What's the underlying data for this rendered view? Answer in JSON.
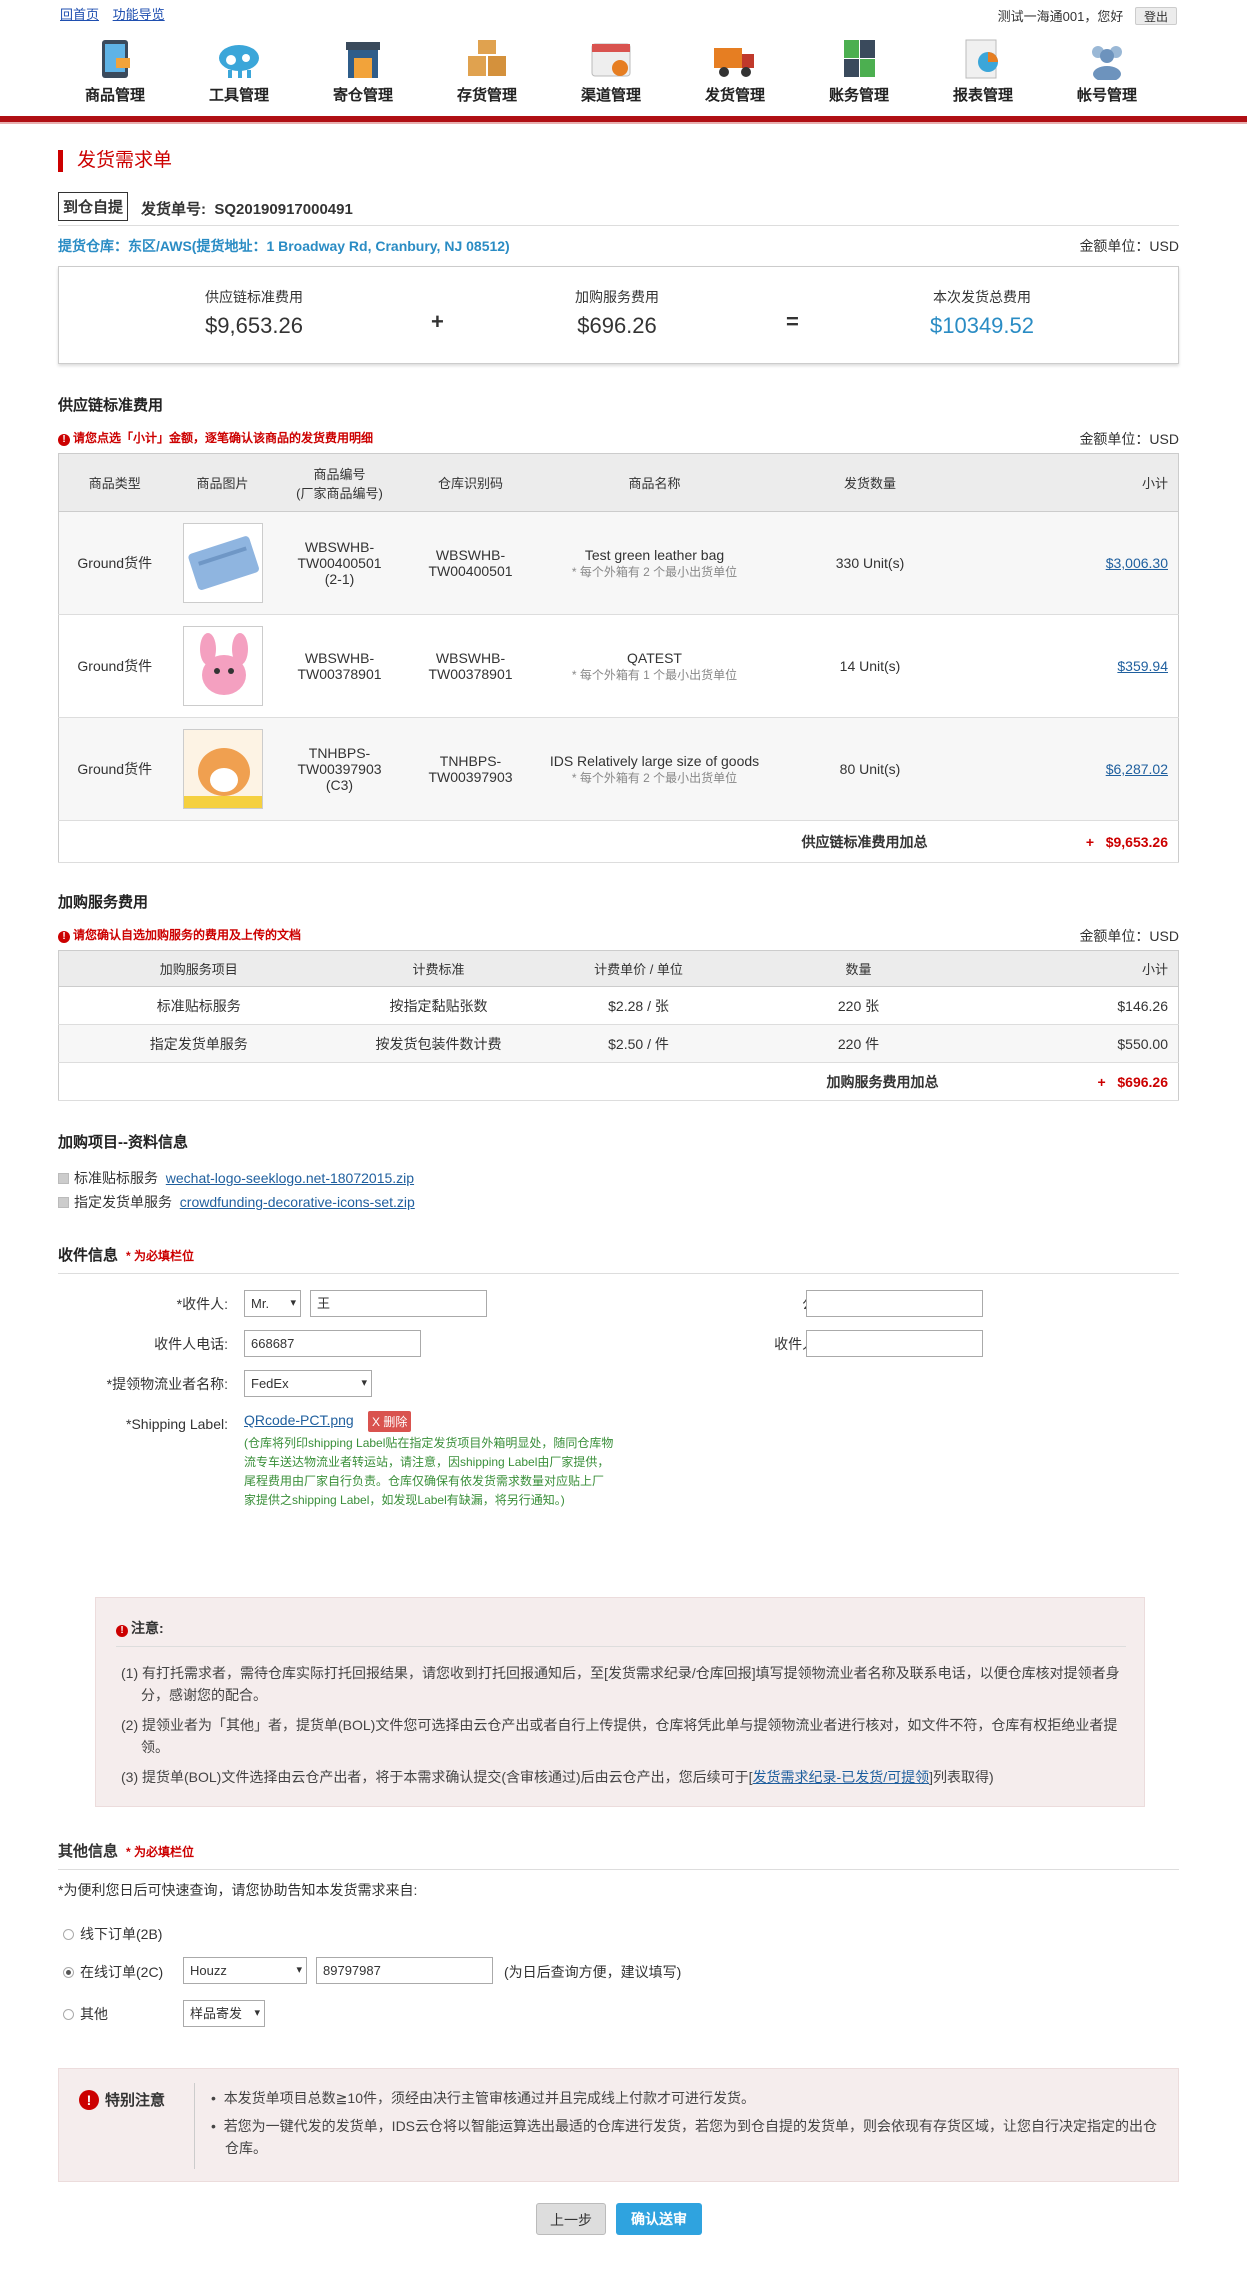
{
  "topbar": {
    "home": "回首页",
    "nav_guide": "功能导览",
    "greeting": "测试一海通001，您好",
    "logout": "登出"
  },
  "nav": [
    {
      "label": "商品管理",
      "icon": "tablet-icon"
    },
    {
      "label": "工具管理",
      "icon": "cloud-tools-icon"
    },
    {
      "label": "寄仓管理",
      "icon": "warehouse-icon"
    },
    {
      "label": "存货管理",
      "icon": "boxes-icon"
    },
    {
      "label": "渠道管理",
      "icon": "calendar-icon"
    },
    {
      "label": "发货管理",
      "icon": "truck-icon"
    },
    {
      "label": "账务管理",
      "icon": "calculator-icon"
    },
    {
      "label": "报表管理",
      "icon": "report-icon"
    },
    {
      "label": "帐号管理",
      "icon": "users-icon"
    }
  ],
  "page_title": "发货需求单",
  "order": {
    "tag": "到仓自提",
    "number_label": "发货单号:",
    "number": "SQ20190917000491"
  },
  "warehouse": "提货仓库：东区/AWS(提货地址：1 Broadway Rd, Cranbury, NJ 08512)",
  "currency_unit": "金额单位：USD",
  "summary": {
    "a_label": "供应链标准费用",
    "a_value": "$9,653.26",
    "plus": "+",
    "b_label": "加购服务费用",
    "b_value": "$696.26",
    "eq": "=",
    "c_label": "本次发货总费用",
    "c_value": "$10349.52",
    "accent": "#2a8cc4"
  },
  "supply": {
    "title": "供应链标准费用",
    "warning": "请您点选「小计」金额，逐笔确认该商品的发货费用明细",
    "headers": [
      "商品类型",
      "商品图片",
      "商品编号\n(厂家商品编号)",
      "仓库识别码",
      "商品名称",
      "发货数量",
      "小计"
    ],
    "rows": [
      {
        "type": "Ground货件",
        "image": "blue-wallet",
        "sku": "WBSWHB-\nTW00400501\n(2-1)",
        "code": "WBSWHB-\nTW00400501",
        "name": "Test green leather bag",
        "sub": "* 每个外箱有 2 个最小出货单位",
        "qty": "330 Unit(s)",
        "subtotal": "$3,006.30"
      },
      {
        "type": "Ground货件",
        "image": "pink-plush",
        "sku": "WBSWHB-\nTW00378901",
        "code": "WBSWHB-\nTW00378901",
        "name": "QATEST",
        "sub": "* 每个外箱有 1 个最小出货单位",
        "qty": "14 Unit(s)",
        "subtotal": "$359.94"
      },
      {
        "type": "Ground货件",
        "image": "hamster-toy",
        "sku": "TNHBPS-\nTW00397903\n(C3)",
        "code": "TNHBPS-\nTW00397903",
        "name": "IDS Relatively large size of goods",
        "sub": "* 每个外箱有 2 个最小出货单位",
        "qty": "80 Unit(s)",
        "subtotal": "$6,287.02"
      }
    ],
    "total_label": "供应链标准费用加总",
    "total_sign": "+",
    "total": "$9,653.26"
  },
  "addon": {
    "title": "加购服务费用",
    "warning": "请您确认自选加购服务的费用及上传的文档",
    "headers": [
      "加购服务项目",
      "计费标准",
      "计费单价 / 单位",
      "数量",
      "小计"
    ],
    "rows": [
      {
        "item": "标准贴标服务",
        "basis": "按指定黏贴张数",
        "price": "$2.28 / 张",
        "qty": "220 张",
        "subtotal": "$146.26"
      },
      {
        "item": "指定发货单服务",
        "basis": "按发货包装件数计费",
        "price": "$2.50 / 件",
        "qty": "220 件",
        "subtotal": "$550.00"
      }
    ],
    "total_label": "加购服务费用加总",
    "total_sign": "+",
    "total": "$696.26"
  },
  "files": {
    "title": "加购项目--资料信息",
    "items": [
      {
        "label": "标准贴标服务",
        "file": "wechat-logo-seeklogo.net-18072015.zip"
      },
      {
        "label": "指定发货单服务",
        "file": "crowdfunding-decorative-icons-set.zip"
      }
    ]
  },
  "recipient": {
    "title": "收件信息",
    "required": "* 为必填栏位",
    "name_label": "*收件人:",
    "salutation": "Mr.",
    "name": "王",
    "company_label": "公司名:",
    "company": "",
    "phone_label": "收件人电话:",
    "phone": "668687",
    "email_label": "收件人邮箱:",
    "email": "",
    "carrier_label": "*提领物流业者名称:",
    "carrier": "FedEx",
    "ship_label": "*Shipping Label:",
    "ship_file": "QRcode-PCT.png",
    "delete": "X 删除",
    "ship_note": "(仓库将列印shipping Label贴在指定发货项目外箱明显处，随同仓库物流专车送达物流业者转运站，请注意，因shipping Label由厂家提供，尾程费用由厂家自行负责。仓库仅确保有依发货需求数量对应贴上厂家提供之shipping Label，如发现Label有缺漏，将另行通知。)"
  },
  "notice": {
    "title": "注意:",
    "items": [
      "(1) 有打托需求者，需待仓库实际打托回报结果，请您收到打托回报通知后，至[发货需求纪录/仓库回报]填写提领物流业者名称及联系电话，以便仓库核对提领者身分，感谢您的配合。",
      "(2) 提领业者为「其他」者，提货单(BOL)文件您可选择由云仓产出或者自行上传提供，仓库将凭此单与提领物流业者进行核对，如文件不符，仓库有权拒绝业者提领。"
    ],
    "item3_pre": "(3) 提货单(BOL)文件选择由云仓产出者，将于本需求确认提交(含审核通过)后由云仓产出，您后续可于[",
    "item3_link": "发货需求纪录-已发货/可提领",
    "item3_post": "]列表取得)"
  },
  "other": {
    "title": "其他信息",
    "required": "* 为必填栏位",
    "question": "*为便利您日后可快速查询，请您协助告知本发货需求来自:",
    "opt1": "线下订单(2B)",
    "opt2": "在线订单(2C)",
    "platform": "Houzz",
    "order_no": "89797987",
    "opt2_hint": "(为日后查询方便，建议填写)",
    "opt3": "其他",
    "opt3_value": "样品寄发"
  },
  "special": {
    "title": "特别注意",
    "items": [
      "本发货单项目总数≧10件，须经由决行主管审核通过并且完成线上付款才可进行发货。",
      "若您为一键代发的发货单，IDS云仓将以智能运算选出最适的仓库进行发货，若您为到仓自提的发货单，则会依现有存货区域，让您自行决定指定的出仓仓库。"
    ]
  },
  "buttons": {
    "prev": "上一步",
    "submit": "确认送审",
    "submit_color": "#2fa3df"
  }
}
